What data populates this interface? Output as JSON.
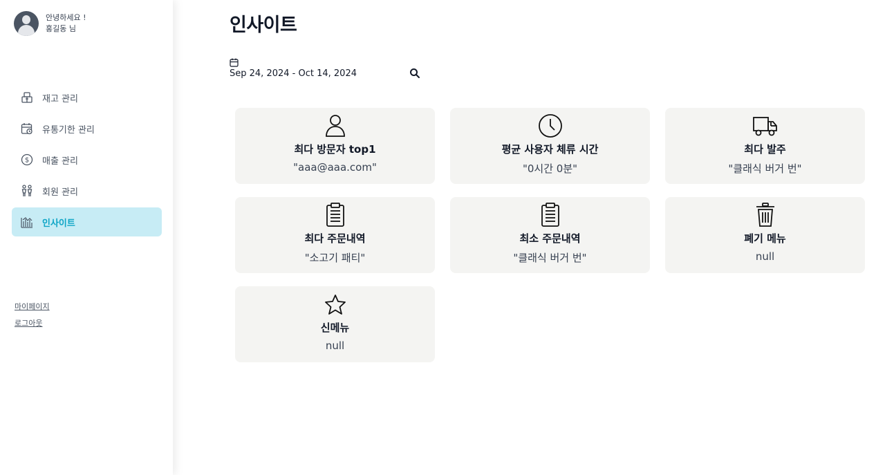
{
  "user": {
    "greeting": "안녕하세요 !",
    "name": "홍길동 님"
  },
  "nav": [
    {
      "label": "재고 관리",
      "icon": "package-icon"
    },
    {
      "label": "유통기한 관리",
      "icon": "calendar-clock-icon"
    },
    {
      "label": "매출 관리",
      "icon": "dollar-circle-icon"
    },
    {
      "label": "회원 관리",
      "icon": "people-icon"
    },
    {
      "label": "인사이트",
      "icon": "chart-bars-icon",
      "active": true
    }
  ],
  "links": {
    "mypage": "마이페이지",
    "logout": "로그아웃"
  },
  "page": {
    "title": "인사이트"
  },
  "date_range": {
    "value": "Sep 24, 2024 - Oct 14, 2024"
  },
  "cards": [
    {
      "title": "최다 방문자 top1",
      "value": "\"aaa@aaa.com\"",
      "icon": "user-icon"
    },
    {
      "title": "평균 사용자 체류 시간",
      "value": "\"0시간 0분\"",
      "icon": "clock-icon"
    },
    {
      "title": "최다 발주",
      "value": "\"클래식 버거 번\"",
      "icon": "truck-icon"
    },
    {
      "title": "최다 주문내역",
      "value": "\"소고기 패티\"",
      "icon": "clipboard-icon"
    },
    {
      "title": "최소 주문내역",
      "value": "\"클래식 버거 번\"",
      "icon": "clipboard-icon"
    },
    {
      "title": "폐기 메뉴",
      "value": "null",
      "icon": "trash-icon"
    },
    {
      "title": "신메뉴",
      "value": "null",
      "icon": "star-icon"
    }
  ],
  "colors": {
    "active_bg": "#c7ecf5",
    "active_text": "#0ea5c6",
    "card_bg": "#f4f4f2"
  }
}
